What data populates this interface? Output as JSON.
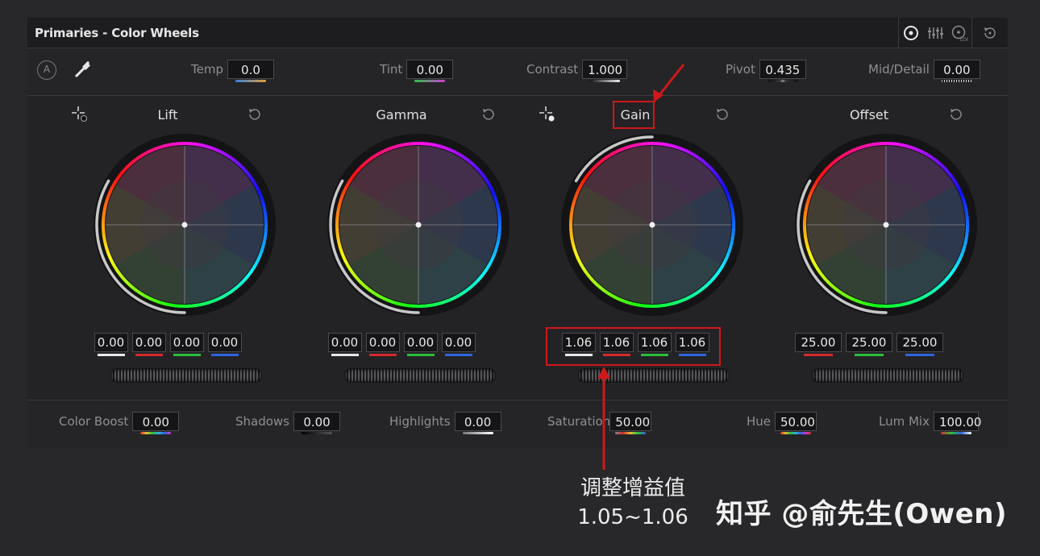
{
  "panel_title": "Primaries - Color Wheels",
  "title_icons": [
    "color-wheels-icon",
    "bars-icon",
    "log-wheels-icon",
    "reset-all-icon"
  ],
  "toolbar": {
    "auto_label": "A",
    "params": [
      {
        "label": "Temp",
        "value": "0.0"
      },
      {
        "label": "Tint",
        "value": "0.00"
      },
      {
        "label": "Contrast",
        "value": "1.000"
      },
      {
        "label": "Pivot",
        "value": "0.435"
      },
      {
        "label": "Mid/Detail",
        "value": "0.00"
      }
    ]
  },
  "wheels": [
    {
      "name": "Lift",
      "values": [
        "0.00",
        "0.00",
        "0.00",
        "0.00"
      ]
    },
    {
      "name": "Gamma",
      "values": [
        "0.00",
        "0.00",
        "0.00",
        "0.00"
      ]
    },
    {
      "name": "Gain",
      "values": [
        "1.06",
        "1.06",
        "1.06",
        "1.06"
      ]
    },
    {
      "name": "Offset",
      "values": [
        "25.00",
        "25.00",
        "25.00"
      ]
    }
  ],
  "bottom": [
    {
      "label": "Color Boost",
      "value": "0.00"
    },
    {
      "label": "Shadows",
      "value": "0.00"
    },
    {
      "label": "Highlights",
      "value": "0.00"
    },
    {
      "label": "Saturation",
      "value": "50.00"
    },
    {
      "label": "Hue",
      "value": "50.00"
    },
    {
      "label": "Lum Mix",
      "value": "100.00"
    }
  ],
  "annotation": {
    "line1": "调整增益值",
    "line2": "1.05~1.06",
    "color": "#d01818"
  },
  "watermark": "知乎 @俞先生(Owen)",
  "colors": {
    "white": "#e8e8e8",
    "red": "#d62a2a",
    "green": "#2bbf3a",
    "blue": "#2f62e0"
  }
}
